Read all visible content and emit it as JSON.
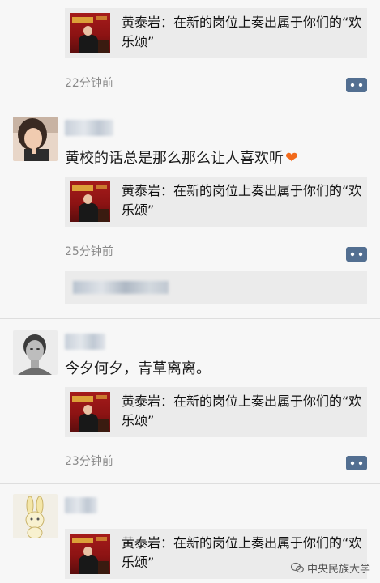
{
  "posts": [
    {
      "link_title": "黄泰岩：在新的岗位上奏出属于你们的“欢乐颂”",
      "time": "22分钟前"
    },
    {
      "text": "黄校的话总是那么那么让人喜欢听",
      "text_emoji": "heart-emoji",
      "link_title": "黄泰岩：在新的岗位上奏出属于你们的“欢乐颂”",
      "time": "25分钟前"
    },
    {
      "text": "今夕何夕，青草离离。",
      "link_title": "黄泰岩：在新的岗位上奏出属于你们的“欢乐颂”",
      "time": "23分钟前"
    },
    {
      "link_title": "黄泰岩：在新的岗位上奏出属于你们的“欢乐颂”"
    }
  ],
  "watermark": "中央民族大学",
  "colors": {
    "background": "#f7f7f7",
    "card": "#ebebeb",
    "comment_button": "#536f91",
    "heart": "#f26a1b",
    "timestamp": "#8a8a8a"
  }
}
